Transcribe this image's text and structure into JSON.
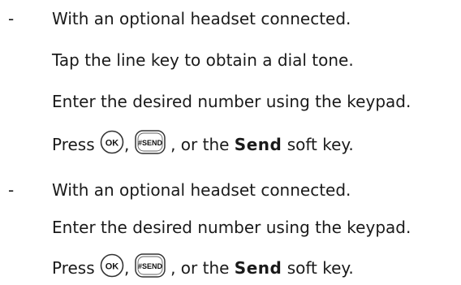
{
  "sections": [
    {
      "bullet": "-",
      "heading": "With an optional headset connected.",
      "steps": [
        "Tap the line key to obtain a dial tone.",
        "Enter the desired number using the keypad."
      ],
      "press": {
        "prefix": "Press",
        "sep1": ",",
        "sep2": ", or the",
        "bold": "Send",
        "suffix": "soft key."
      }
    },
    {
      "bullet": "-",
      "heading": "With an optional headset connected.",
      "steps": [
        "Enter the desired number using the keypad."
      ],
      "press": {
        "prefix": "Press",
        "sep1": ",",
        "sep2": ", or the",
        "bold": "Send",
        "suffix": "soft key."
      }
    }
  ],
  "keys": {
    "ok_label": "OK",
    "hash_label": "#SEND"
  },
  "icons": {
    "ok": "ok-key-icon",
    "hash": "hash-send-key-icon"
  }
}
